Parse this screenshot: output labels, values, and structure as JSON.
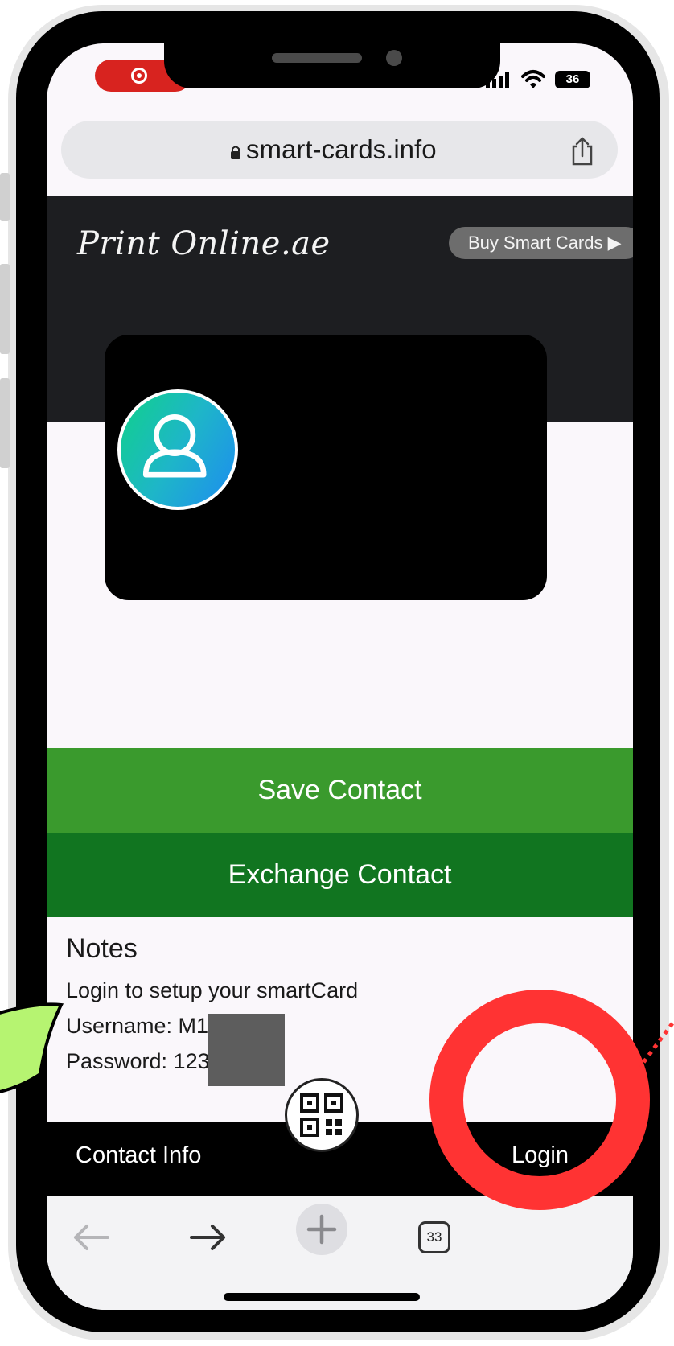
{
  "status_bar": {
    "battery": "36",
    "recording_icon": "record-icon",
    "signal_icon": "cellular-signal-icon",
    "wifi_icon": "wifi-icon"
  },
  "url_bar": {
    "url": "smart-cards.info",
    "lock_icon": "lock-icon",
    "share_icon": "share-icon"
  },
  "header": {
    "brand": "Print Online.ae",
    "buy_button": "Buy Smart Cards ▶"
  },
  "card": {
    "avatar_icon": "user-avatar-icon"
  },
  "actions": {
    "save_label": "Save Contact",
    "exchange_label": "Exchange Contact"
  },
  "notes": {
    "title": "Notes",
    "lines": [
      "Login to setup your smartCard",
      "Username: M1",
      "Password: 123"
    ]
  },
  "bottom_nav": {
    "contact_info": "Contact Info",
    "login": "Login",
    "qr_icon": "qr-code-icon"
  },
  "browser_toolbar": {
    "tab_count": "33",
    "back_icon": "back-arrow-icon",
    "forward_icon": "forward-arrow-icon",
    "new_tab_icon": "plus-icon"
  },
  "colors": {
    "save_green": "#3a9a2d",
    "exchange_green": "#117520",
    "header_dark": "#1d1e21",
    "annotation_red": "#ff3333",
    "annotation_lime": "#b6f471"
  }
}
